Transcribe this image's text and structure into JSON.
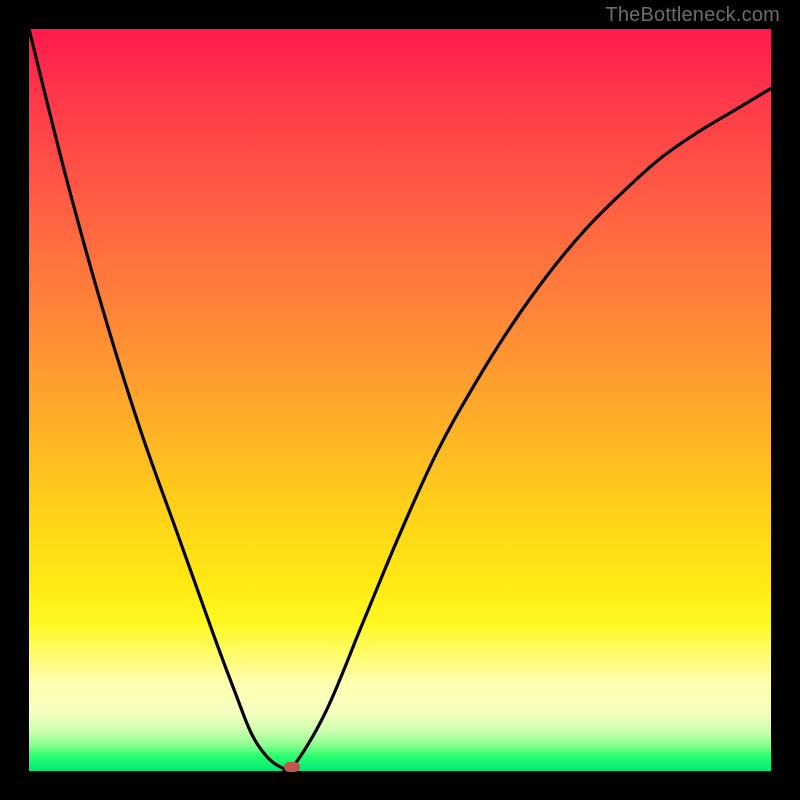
{
  "watermark": "TheBottleneck.com",
  "chart_data": {
    "type": "line",
    "title": "",
    "xlabel": "",
    "ylabel": "",
    "xlim": [
      0,
      100
    ],
    "ylim": [
      0,
      100
    ],
    "grid": false,
    "legend": false,
    "series": [
      {
        "name": "curve",
        "color": "#000000",
        "x": [
          0,
          5,
          10,
          15,
          20,
          25,
          28,
          30,
          32,
          34,
          35.5,
          40,
          45,
          50,
          55,
          60,
          65,
          70,
          75,
          80,
          85,
          90,
          95,
          100
        ],
        "values": [
          100,
          80,
          62,
          46,
          32,
          18,
          10,
          5,
          2,
          0.5,
          0.5,
          8,
          20,
          32,
          43,
          52,
          60,
          67,
          73,
          78,
          82.5,
          86,
          89,
          92
        ]
      }
    ],
    "markers": [
      {
        "name": "optimal-point",
        "x": 35.5,
        "y": 0.5,
        "color": "#c0564e"
      }
    ],
    "gradient_stops": [
      {
        "pct": 0,
        "color": "#ff1a4d"
      },
      {
        "pct": 10,
        "color": "#ff3a4a"
      },
      {
        "pct": 22,
        "color": "#ff5a44"
      },
      {
        "pct": 34,
        "color": "#ff7a3c"
      },
      {
        "pct": 46,
        "color": "#ff9a30"
      },
      {
        "pct": 56,
        "color": "#ffb824"
      },
      {
        "pct": 66,
        "color": "#ffd418"
      },
      {
        "pct": 74,
        "color": "#ffe814"
      },
      {
        "pct": 80,
        "color": "#fff820"
      },
      {
        "pct": 88,
        "color": "#ffffae"
      },
      {
        "pct": 92,
        "color": "#f7ffc0"
      },
      {
        "pct": 94.5,
        "color": "#d0ffb0"
      },
      {
        "pct": 96.5,
        "color": "#8cff90"
      },
      {
        "pct": 98,
        "color": "#2bff70"
      },
      {
        "pct": 100,
        "color": "#00e676"
      }
    ]
  }
}
